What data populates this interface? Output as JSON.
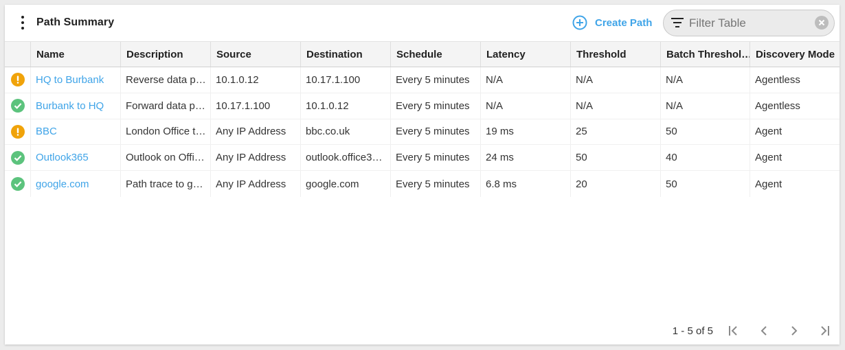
{
  "header": {
    "title": "Path Summary",
    "create_label": "Create Path",
    "filter_placeholder": "Filter Table"
  },
  "colors": {
    "accent": "#3fa4e8",
    "warning": "#f0a30a",
    "success": "#5cc37d"
  },
  "table": {
    "columns": [
      "",
      "Name",
      "Description",
      "Source",
      "Destination",
      "Schedule",
      "Latency",
      "Threshold",
      "Batch Threshol…",
      "Discovery Mode"
    ],
    "rows": [
      {
        "status": "warning",
        "name": "HQ to Burbank",
        "description": "Reverse data pa…",
        "source": "10.1.0.12",
        "destination": "10.17.1.100",
        "schedule": "Every 5 minutes",
        "latency": "N/A",
        "threshold": "N/A",
        "batch_threshold": "N/A",
        "discovery_mode": "Agentless"
      },
      {
        "status": "ok",
        "name": "Burbank to HQ",
        "description": "Forward data p…",
        "source": "10.17.1.100",
        "destination": "10.1.0.12",
        "schedule": "Every 5 minutes",
        "latency": "N/A",
        "threshold": "N/A",
        "batch_threshold": "N/A",
        "discovery_mode": "Agentless"
      },
      {
        "status": "warning",
        "name": "BBC",
        "description": "London Office t…",
        "source": "Any IP Address",
        "destination": "bbc.co.uk",
        "schedule": "Every 5 minutes",
        "latency": "19 ms",
        "threshold": "25",
        "batch_threshold": "50",
        "discovery_mode": "Agent"
      },
      {
        "status": "ok",
        "name": "Outlook365",
        "description": "Outlook on Offi…",
        "source": "Any IP Address",
        "destination": "outlook.office3…",
        "schedule": "Every 5 minutes",
        "latency": "24 ms",
        "threshold": "50",
        "batch_threshold": "40",
        "discovery_mode": "Agent"
      },
      {
        "status": "ok",
        "name": "google.com",
        "description": "Path trace to go…",
        "source": "Any IP Address",
        "destination": "google.com",
        "schedule": "Every 5 minutes",
        "latency": "6.8 ms",
        "threshold": "20",
        "batch_threshold": "50",
        "discovery_mode": "Agent"
      }
    ]
  },
  "pagination": {
    "range_label": "1 - 5 of 5"
  }
}
